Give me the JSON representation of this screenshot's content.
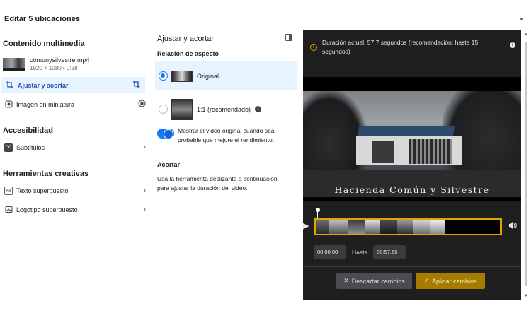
{
  "header": {
    "title": "Editar 5 ubicaciones",
    "close": "×"
  },
  "left": {
    "media_heading": "Contenido multimedia",
    "file_name": "comunysilvestre.mp4",
    "file_meta": "1920 × 1080 • 0:58",
    "items": [
      {
        "label": "Ajustar y acortar",
        "icon": "crop-icon"
      },
      {
        "label": "Imagen en miniatura",
        "icon": "thumbnail-icon"
      }
    ],
    "accessibility_heading": "Accesibilidad",
    "subtitles_label": "Subtítulos",
    "subtitles_icon": "CC",
    "creative_heading": "Herramientas creativas",
    "creative_items": [
      {
        "label": "Texto superpuesto",
        "icon": "Aa"
      },
      {
        "label": "Logotipo superpuesto",
        "icon": "image-icon"
      }
    ]
  },
  "middle": {
    "title": "Ajustar y acortar",
    "aspect_heading": "Relación de aspecto",
    "options": [
      {
        "label": "Original",
        "selected": true
      },
      {
        "label": "1:1  (recomendado)",
        "selected": false
      }
    ],
    "toggle_text": "Mostrar el video original cuando sea probable que mejore el rendimiento.",
    "toggle_on": true,
    "trim_heading": "Acortar",
    "trim_text": "Usa la herramienta deslizante a continuación para ajustar la duración del video."
  },
  "panel": {
    "warning": "Duración actual: 57.7 segundos (recomendación: hasta 15 segundos)",
    "video_caption": "Hacienda Común y Silvestre",
    "start_time": "00:00.00",
    "to_label": "Hasta",
    "end_time": "00:57.66",
    "discard_label": "Descartar cambios",
    "apply_label": "Aplicar cambios",
    "accent_color": "#e6a300"
  }
}
